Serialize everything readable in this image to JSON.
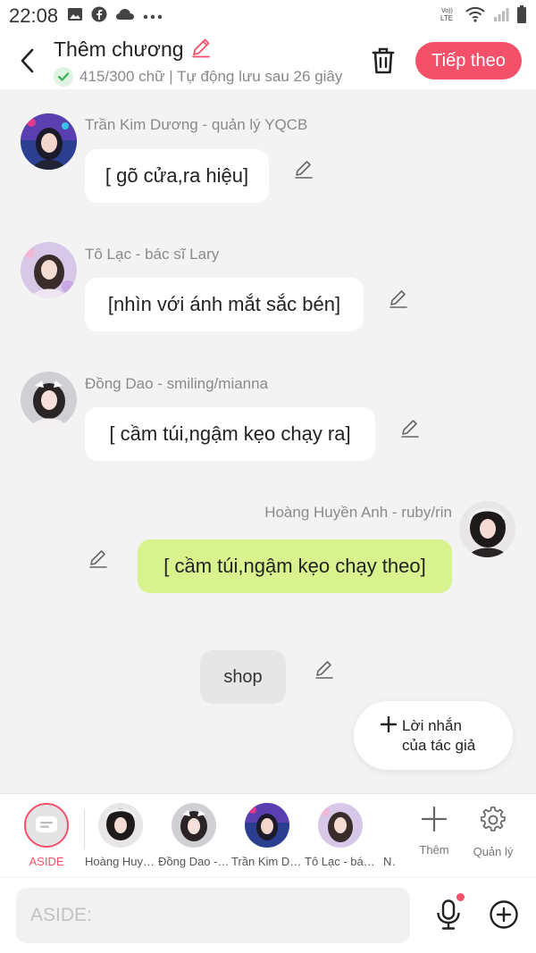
{
  "status_bar": {
    "time": "22:08"
  },
  "header": {
    "title": "Thêm chương",
    "subtitle": "415/300 chữ | Tự động lưu sau 26 giây",
    "next_label": "Tiếp theo"
  },
  "messages": [
    {
      "sender": "Trần Kim Dương - quản lý YQCB",
      "text": "[ gõ cửa,ra hiệu]"
    },
    {
      "sender": "Tô Lạc - bác sĩ Lary",
      "text": "[nhìn với ánh mắt sắc bén]"
    },
    {
      "sender": "Đồng Dao - smiling/mianna",
      "text": "[ cầm túi,ngậm kẹo chạy ra]"
    },
    {
      "sender": "Hoàng Huyền Anh - ruby/rin",
      "text": "[ cầm túi,ngậm kẹo chạy theo]"
    }
  ],
  "aside_message": "shop",
  "author_note": {
    "line1": "Lời nhắn",
    "line2": "của tác giả"
  },
  "character_bar": {
    "aside_label": "ASIDE",
    "characters": [
      "Hoàng Huyền Anh",
      "Đồng Dao - smiling",
      "Trần Kim Dương",
      "Tô Lạc - bác sĩ",
      "Ng"
    ],
    "add_label": "Thêm",
    "manage_label": "Quản lý"
  },
  "input": {
    "placeholder": "ASIDE:"
  },
  "colors": {
    "accent": "#f4506a",
    "green_bubble": "#d8f28e",
    "background": "#f3f3f3"
  }
}
